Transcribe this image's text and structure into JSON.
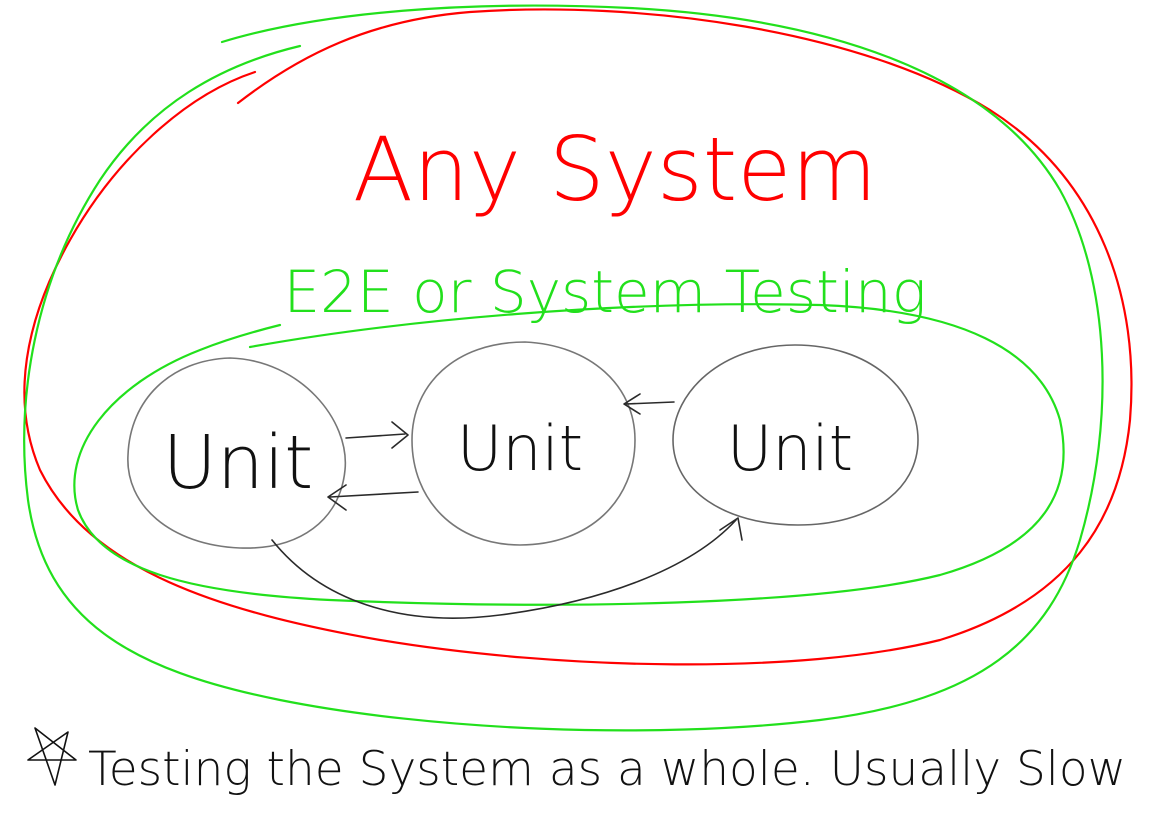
{
  "title": "Any System",
  "subtitle": "E2E or System Testing",
  "units": [
    {
      "label": "Unit"
    },
    {
      "label": "Unit"
    },
    {
      "label": "Unit"
    }
  ],
  "note": "Testing the System as a whole. Usually Slow",
  "colors": {
    "red": "#ff0000",
    "green": "#22e01c",
    "unit_outline": "#777777",
    "ink": "#111111",
    "arrow": "#2a2a2a"
  }
}
